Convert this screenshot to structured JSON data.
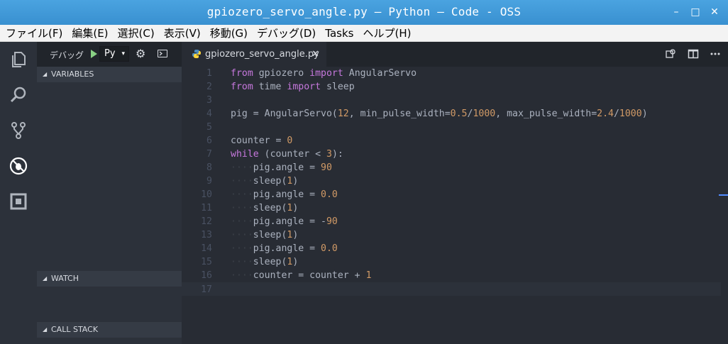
{
  "window": {
    "title": "gpiozero_servo_angle.py — Python — Code - OSS",
    "controls": {
      "minimize": "–",
      "maximize": "□",
      "close": "✕"
    }
  },
  "menu": [
    "ファイル(F)",
    "編集(E)",
    "選択(C)",
    "表示(V)",
    "移動(G)",
    "デバッグ(D)",
    "Tasks",
    "ヘルプ(H)"
  ],
  "activity_icons": [
    "files-icon",
    "search-icon",
    "source-control-icon",
    "debug-icon",
    "extensions-icon"
  ],
  "debug_toolbar": {
    "label": "デバッグ",
    "configuration": "Py",
    "caret": "▾",
    "gear": "⚙"
  },
  "sections": {
    "variables": "VARIABLES",
    "watch": "WATCH",
    "call_stack": "CALL STACK"
  },
  "editor": {
    "tab_label": "gpiozero_servo_angle.py",
    "tab_close": "✕",
    "lines": [
      {
        "n": "1",
        "t": "from gpiozero import AngularServo"
      },
      {
        "n": "2",
        "t": "from time import sleep"
      },
      {
        "n": "3",
        "t": ""
      },
      {
        "n": "4",
        "t": "pig = AngularServo(12, min_pulse_width=0.5/1000, max_pulse_width=2.4/1000)"
      },
      {
        "n": "5",
        "t": ""
      },
      {
        "n": "6",
        "t": "counter = 0"
      },
      {
        "n": "7",
        "t": "while (counter < 3):"
      },
      {
        "n": "8",
        "t": "    pig.angle = 90"
      },
      {
        "n": "9",
        "t": "    sleep(1)"
      },
      {
        "n": "10",
        "t": "    pig.angle = 0.0"
      },
      {
        "n": "11",
        "t": "    sleep(1)"
      },
      {
        "n": "12",
        "t": "    pig.angle = -90"
      },
      {
        "n": "13",
        "t": "    sleep(1)"
      },
      {
        "n": "14",
        "t": "    pig.angle = 0.0"
      },
      {
        "n": "15",
        "t": "    sleep(1)"
      },
      {
        "n": "16",
        "t": "    counter = counter + 1"
      },
      {
        "n": "17",
        "t": ""
      }
    ]
  },
  "colors": {
    "titlebar": "#3990d0",
    "keyword": "#c678dd",
    "number": "#d19a66",
    "text": "#abb2bf",
    "line_number": "#495162",
    "accent": "#528bff"
  }
}
